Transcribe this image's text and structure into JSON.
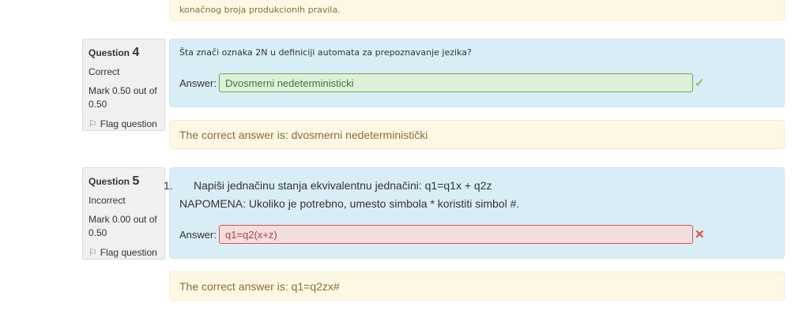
{
  "prev_feedback": "konačnog broja produkcionih pravila.",
  "questions": [
    {
      "label": "Question",
      "number": "4",
      "state": "Correct",
      "mark": "Mark 0.50 out of",
      "mark2": "0.50",
      "flag": "Flag question",
      "text": "Šta znači oznaka 2N u definiciji automata za prepoznavanje jezika?",
      "answer_label": "Answer:",
      "answer": "Dvosmerni nedeterministicki",
      "feedback": "The correct answer is: dvosmerni nedeterministički"
    },
    {
      "label": "Question",
      "number": "5",
      "state": "Incorrect",
      "mark": "Mark 0.00 out of",
      "mark2": "0.50",
      "flag": "Flag question",
      "list_num": "1.",
      "text": "Napiši jednačinu stanja ekvivalentnu jednačini: q1=q1x + q2z",
      "note": "NAPOMENA: Ukoliko je potrebno, umesto simbola * koristiti simbol #.",
      "answer_label": "Answer:",
      "answer": "q1=q2(x+z)",
      "feedback": "The correct answer is: q1=q2zx#"
    }
  ]
}
